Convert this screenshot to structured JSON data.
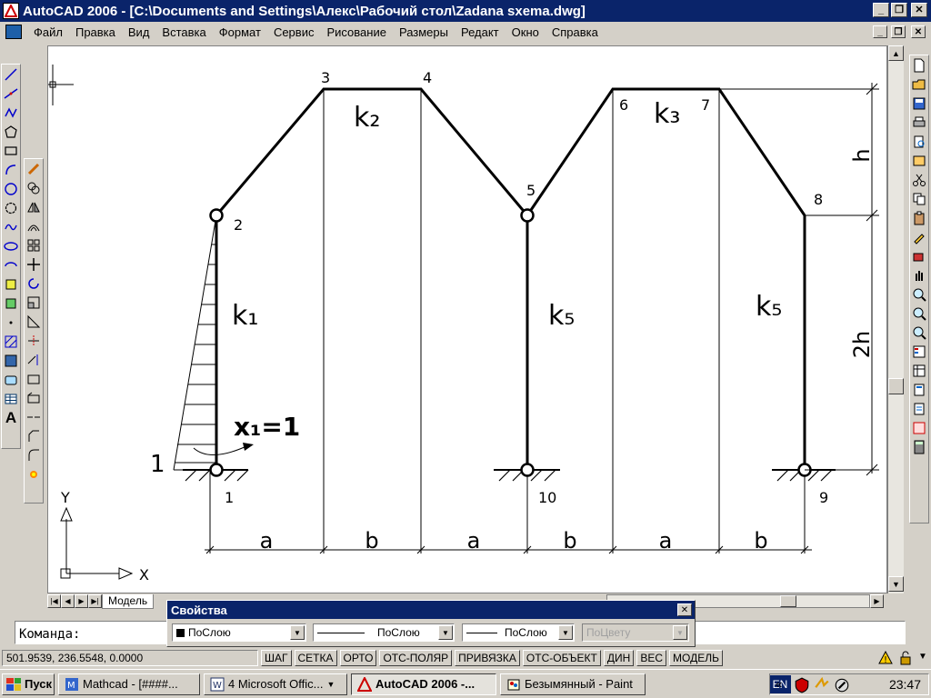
{
  "window": {
    "title": "AutoCAD 2006 - [C:\\Documents and Settings\\Алекс\\Рабочий стол\\Zadana sxema.dwg]"
  },
  "menu": [
    "Файл",
    "Правка",
    "Вид",
    "Вставка",
    "Формат",
    "Сервис",
    "Рисование",
    "Размеры",
    "Редакт",
    "Окно",
    "Справка"
  ],
  "drawing": {
    "nodes": [
      "1",
      "2",
      "3",
      "4",
      "5",
      "6",
      "7",
      "8",
      "9",
      "10"
    ],
    "stiffness": {
      "k1": "k₁",
      "k2": "k₂",
      "k3": "k₃",
      "k5a": "k₅",
      "k5b": "k₅"
    },
    "unknown": "x₁=1",
    "load_value": "1",
    "dim_h": "h",
    "dim_2h": "2h",
    "dims_bottom": [
      "a",
      "b",
      "a",
      "b",
      "a",
      "b"
    ],
    "ucs_x": "X",
    "ucs_y": "Y"
  },
  "tabs": {
    "model": "Модель"
  },
  "properties": {
    "title": "Свойства",
    "color": "ПоСлою",
    "linetype": "ПоСлою",
    "lineweight": "ПоСлою",
    "plotstyle": "ПоЦвету"
  },
  "command": {
    "prompt": "Команда:"
  },
  "status": {
    "coords": "501.9539, 236.5548, 0.0000",
    "toggles": [
      "ШАГ",
      "СЕТКА",
      "ОРТО",
      "ОТС-ПОЛЯР",
      "ПРИВЯЗКА",
      "ОТС-ОБЪЕКТ",
      "ДИН",
      "ВЕС",
      "МОДЕЛЬ"
    ]
  },
  "taskbar": {
    "start": "Пуск",
    "tasks": [
      "Mathcad - [####...",
      "4 Microsoft Offic...",
      "AutoCAD 2006 -...",
      "Безымянный - Paint"
    ],
    "lang": "EN",
    "time": "23:47"
  }
}
